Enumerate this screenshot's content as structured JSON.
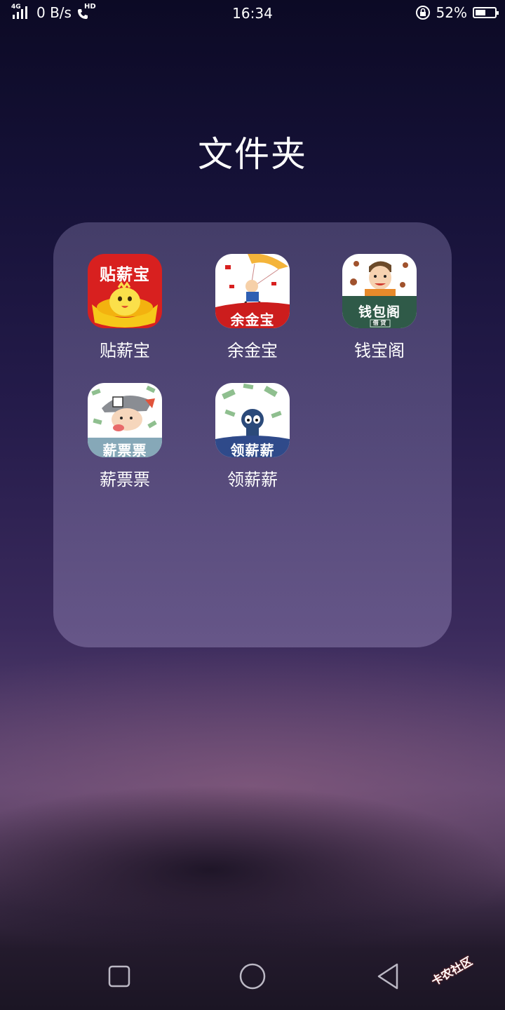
{
  "status_bar": {
    "network_type": "4G",
    "net_speed": "0 B/s",
    "hd_label": "HD",
    "time": "16:34",
    "battery_percent": "52%",
    "battery_level": 0.52
  },
  "folder": {
    "title": "文件夹",
    "apps": [
      {
        "label": "贴薪宝",
        "icon_text": "贴薪宝",
        "icon": "tiexinbao-icon"
      },
      {
        "label": "余金宝",
        "icon_text": "余金宝",
        "icon": "yujinbao-icon"
      },
      {
        "label": "钱宝阁",
        "icon_text": "钱包阁",
        "icon_subtext": "借 贷",
        "icon": "qianbaoge-icon"
      },
      {
        "label": "薪票票",
        "icon_text": "薪票票",
        "icon": "xinpiaopiao-icon"
      },
      {
        "label": "领薪薪",
        "icon_text": "领薪薪",
        "icon": "lingxinxin-icon"
      }
    ]
  },
  "nav": {
    "recent": "recent-apps-icon",
    "home": "home-icon",
    "back": "back-icon"
  },
  "watermark": {
    "text": "卡农社区"
  }
}
